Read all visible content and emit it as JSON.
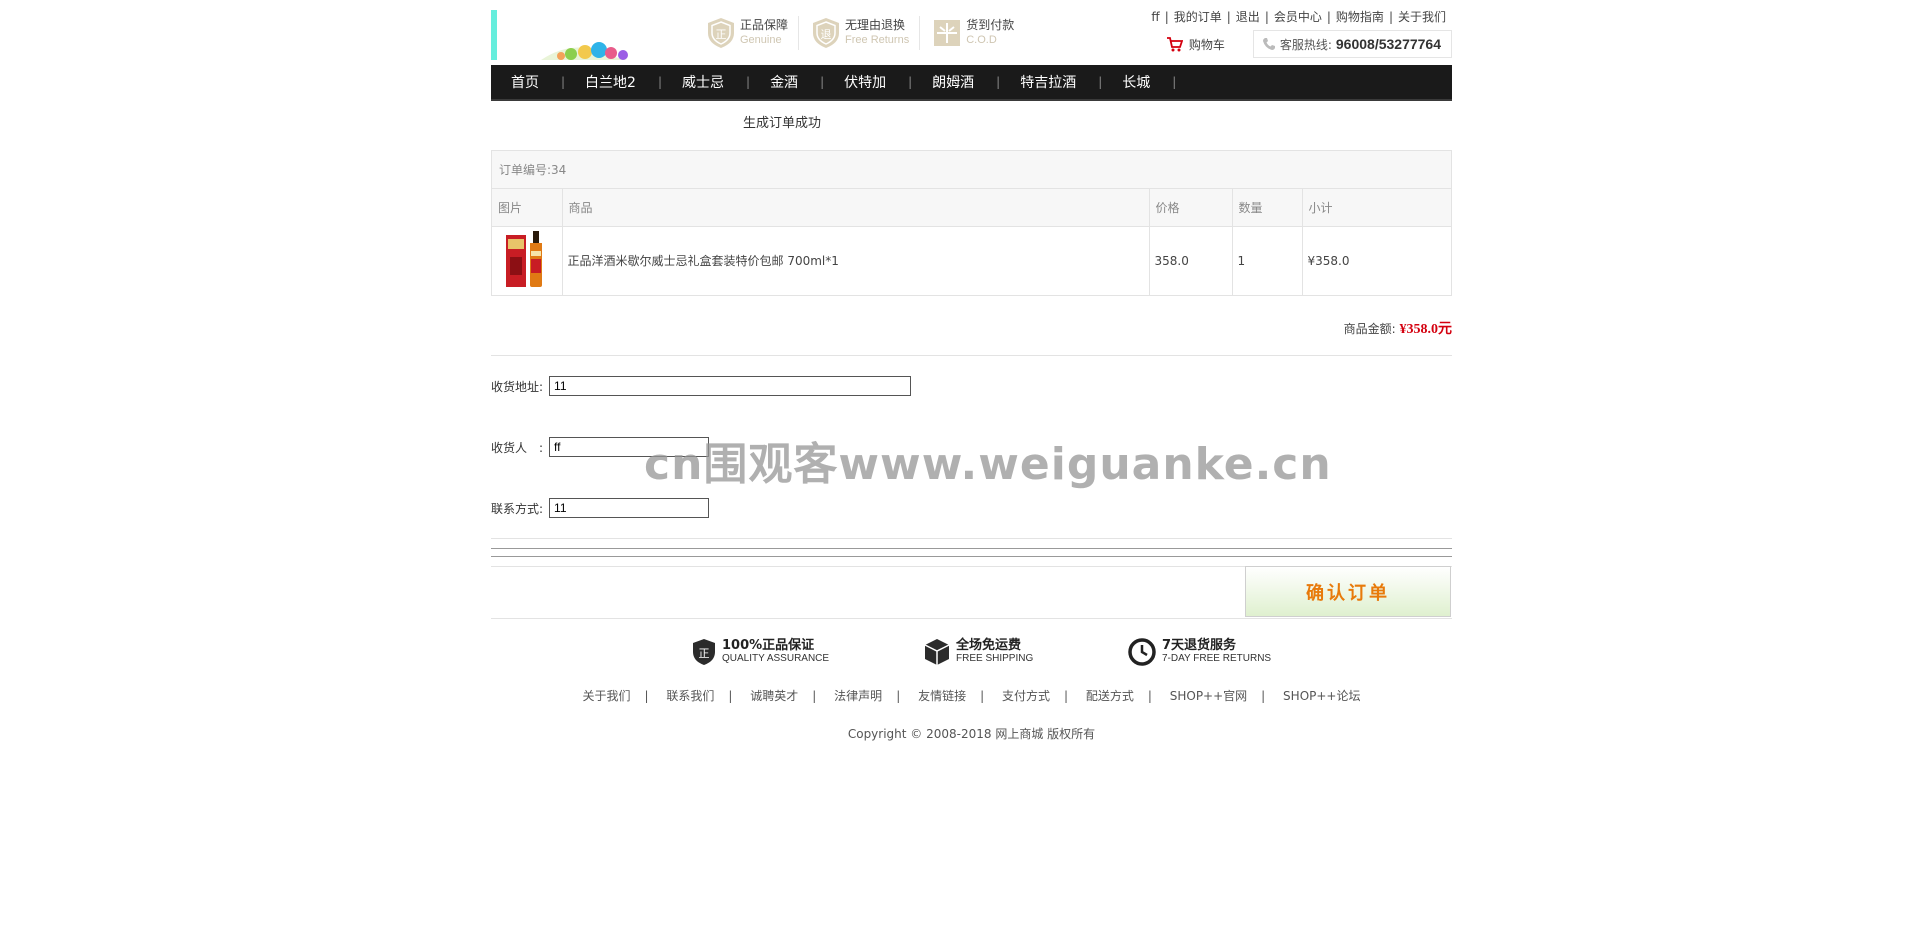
{
  "header": {
    "guarantees": [
      {
        "cn": "正品保障",
        "en": "Genuine",
        "icon": "genuine-shield-icon"
      },
      {
        "cn": "无理由退换",
        "en": "Free Returns",
        "icon": "return-shield-icon"
      },
      {
        "cn": "货到付款",
        "en": "C.O.D",
        "icon": "cod-box-icon"
      }
    ],
    "top_links": {
      "user": "ff",
      "my_orders": "我的订单",
      "logout": "退出",
      "member_center": "会员中心",
      "shopping_guide": "购物指南",
      "about_us": "关于我们"
    },
    "cart_label": "购物车",
    "hotline_label": "客服热线:",
    "hotline_number": "96008/53277764"
  },
  "nav": {
    "items": [
      "首页",
      "白兰地2",
      "威士忌",
      "金酒",
      "伏特加",
      "朗姆酒",
      "特吉拉酒",
      "长城"
    ]
  },
  "main": {
    "success_message": "生成订单成功",
    "order_number": "订单编号:34",
    "table": {
      "headers": [
        "图片",
        "商品",
        "价格",
        "数量",
        "小计"
      ],
      "rows": [
        {
          "product": "正品洋酒米歇尔威士忌礼盒套装特价包邮 700ml*1",
          "price": "358.0",
          "qty": "1",
          "subtotal": "¥358.0"
        }
      ]
    },
    "total_label": "商品金额:",
    "total_amount": "¥358.0元",
    "form": {
      "address_label": "收货地址:",
      "address_value": "11",
      "receiver_label": "收货人　:",
      "receiver_value": "ff",
      "phone_label": "联系方式:",
      "phone_value": "11"
    },
    "confirm_label": "确认订单"
  },
  "footer": {
    "services": [
      {
        "cn": "100%正品保证",
        "en": "QUALITY ASSURANCE",
        "icon": "quality-shield-icon"
      },
      {
        "cn": "全场免运费",
        "en": "FREE SHIPPING",
        "icon": "shipping-box-icon"
      },
      {
        "cn": "7天退货服务",
        "en": "7-DAY FREE RETURNS",
        "icon": "clock-icon"
      }
    ],
    "links": [
      "关于我们",
      "联系我们",
      "诚聘英才",
      "法律声明",
      "友情链接",
      "支付方式",
      "配送方式",
      "SHOP++官网",
      "SHOP++论坛"
    ],
    "copyright": "Copyright © 2008-2018 网上商城 版权所有"
  },
  "watermark": "cn围观客www.weiguanke.cn",
  "colors": {
    "nav_bg": "#1a1a1a",
    "price_red": "#d4000f",
    "confirm_orange": "#e87a0b",
    "logo_bar": "#66eedd"
  }
}
